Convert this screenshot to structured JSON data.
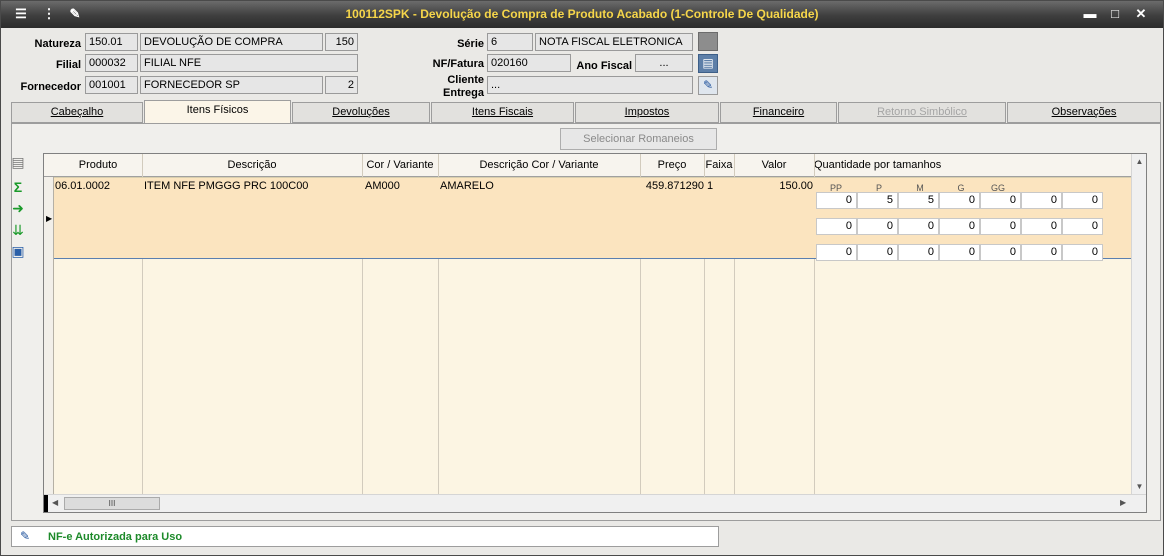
{
  "window": {
    "title": "100112SPK - Devolução de Compra de Produto Acabado (1-Controle De Qualidade)",
    "controls": {
      "minimize": "▬",
      "maximize": "□",
      "close": "✕"
    }
  },
  "header": {
    "natureza": {
      "label": "Natureza",
      "code": "150.01",
      "description": "DEVOLUÇÃO DE COMPRA",
      "number": "150"
    },
    "filial": {
      "label": "Filial",
      "code": "000032",
      "description": "FILIAL NFE"
    },
    "fornecedor": {
      "label": "Fornecedor",
      "code": "001001",
      "description": "FORNECEDOR SP",
      "number": "2"
    },
    "serie": {
      "label": "Série",
      "code": "6",
      "description": "NOTA FISCAL ELETRONICA"
    },
    "nf_fatura": {
      "label": "NF/Fatura",
      "value": "020160"
    },
    "ano_fiscal": {
      "label": "Ano Fiscal",
      "value": "..."
    },
    "cliente_entrega": {
      "label_line1": "Cliente",
      "label_line2": "Entrega",
      "value": "..."
    }
  },
  "tabs": [
    {
      "label": "Cabeçalho",
      "state": "normal"
    },
    {
      "label": "Itens Físicos",
      "state": "active"
    },
    {
      "label": "Devoluções",
      "state": "normal"
    },
    {
      "label": "Itens Fiscais",
      "state": "normal"
    },
    {
      "label": "Impostos",
      "state": "normal"
    },
    {
      "label": "Financeiro",
      "state": "normal"
    },
    {
      "label": "Retorno Simbólico",
      "state": "disabled"
    },
    {
      "label": "Observações",
      "state": "normal"
    }
  ],
  "selecionar_romaneios_label": "Selecionar Romaneios",
  "grid": {
    "columns": [
      "Produto",
      "Descrição",
      "Cor / Variante",
      "Descrição Cor / Variante",
      "Preço",
      "Faixa",
      "Valor",
      "Quantidade por tamanhos"
    ],
    "rows": [
      {
        "produto": "06.01.0002",
        "descricao": "ITEM NFE PMGGG PRC 100C00",
        "cor_variante": "AM000",
        "descricao_cor": "AMARELO",
        "preco": "459.871290",
        "faixa": "1",
        "valor": "150.00",
        "sizes": [
          "PP",
          "P",
          "M",
          "G",
          "GG"
        ],
        "qty_rows": [
          [
            "0",
            "5",
            "5",
            "0",
            "0",
            "0",
            "0"
          ],
          [
            "0",
            "0",
            "0",
            "0",
            "0",
            "0",
            "0"
          ],
          [
            "0",
            "0",
            "0",
            "0",
            "0",
            "0",
            "0"
          ]
        ]
      }
    ],
    "hscroll_thumb": "III"
  },
  "status": {
    "text": "NF-e Autorizada para Uso"
  }
}
